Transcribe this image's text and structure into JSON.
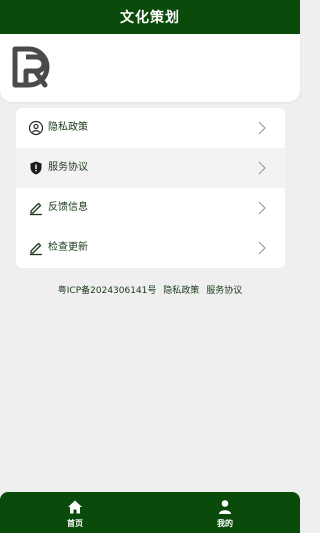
{
  "header": {
    "title": "文化策划"
  },
  "profile": {
    "logo_icon": "brand-logo-icon"
  },
  "menu": {
    "items": [
      {
        "label": "隐私政策",
        "icon": "user-circle-icon"
      },
      {
        "label": "服务协议",
        "icon": "shield-icon"
      },
      {
        "label": "反馈信息",
        "icon": "edit-pen-icon"
      },
      {
        "label": "检查更新",
        "icon": "edit-pen-icon"
      }
    ]
  },
  "footer": {
    "icp": "粤ICP备2024306141号",
    "privacy": "隐私政策",
    "service": "服务协议"
  },
  "tabbar": {
    "home_label": "首页",
    "mine_label": "我的"
  },
  "colors": {
    "brand_green": "#0a4a0a",
    "page_bg": "#efefef"
  }
}
